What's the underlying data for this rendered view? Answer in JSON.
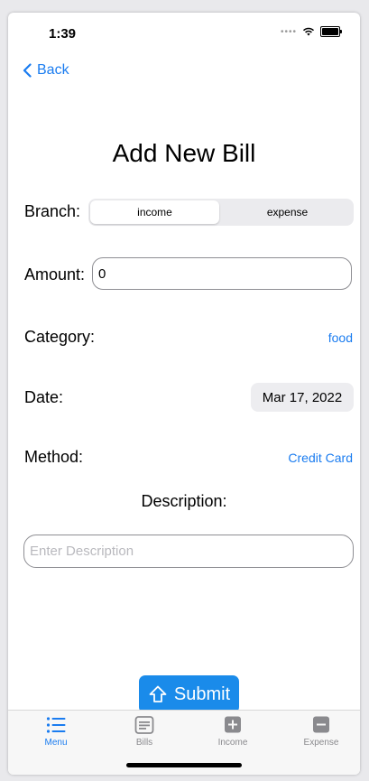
{
  "status": {
    "time": "1:39"
  },
  "nav": {
    "back_label": "Back"
  },
  "page": {
    "title": "Add New Bill"
  },
  "form": {
    "branch_label": "Branch:",
    "branch_options": [
      "income",
      "expense"
    ],
    "branch_selected": "income",
    "amount_label": "Amount:",
    "amount_value": "0",
    "category_label": "Category:",
    "category_value": "food",
    "date_label": "Date:",
    "date_value": "Mar 17, 2022",
    "method_label": "Method:",
    "method_value": "Credit Card",
    "description_label": "Description:",
    "description_placeholder": "Enter Description",
    "description_value": ""
  },
  "submit": {
    "label": "Submit"
  },
  "tabbar": {
    "items": [
      {
        "label": "Menu",
        "icon": "list-icon",
        "active": true
      },
      {
        "label": "Bills",
        "icon": "document-icon",
        "active": false
      },
      {
        "label": "Income",
        "icon": "plus-square-icon",
        "active": false
      },
      {
        "label": "Expense",
        "icon": "minus-square-icon",
        "active": false
      }
    ]
  },
  "colors": {
    "accent": "#1a7cf0",
    "submit_bg": "#1a8bea",
    "inactive": "#8a8a8e"
  }
}
